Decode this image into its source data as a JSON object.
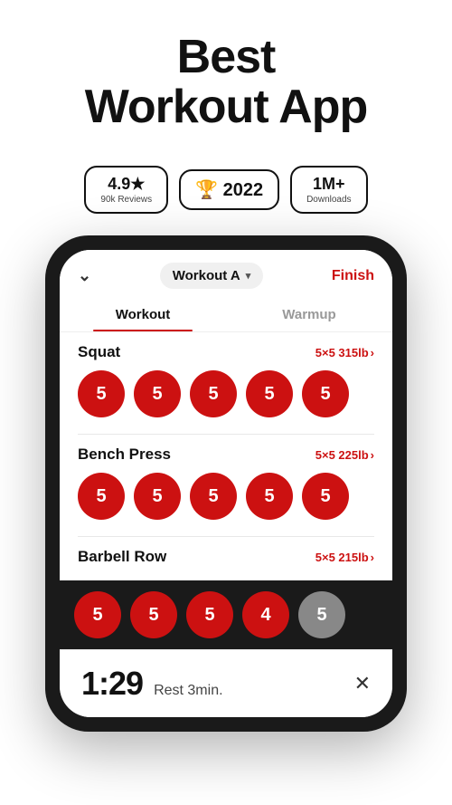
{
  "header": {
    "title_line1": "Best",
    "title_line2": "Workout App"
  },
  "badges": [
    {
      "id": "rating",
      "main": "4.9★",
      "sub": "90k Reviews"
    },
    {
      "id": "award",
      "main": "🏆 2022",
      "sub": ""
    },
    {
      "id": "downloads",
      "main": "1M+",
      "sub": "Downloads"
    }
  ],
  "phone": {
    "workout_label": "Workout A",
    "finish_label": "Finish",
    "tabs": [
      {
        "id": "workout",
        "label": "Workout",
        "active": true
      },
      {
        "id": "warmup",
        "label": "Warmup",
        "active": false
      }
    ],
    "exercises": [
      {
        "name": "Squat",
        "detail": "5×5 315lb",
        "sets": [
          5,
          5,
          5,
          5,
          5
        ],
        "gray": []
      },
      {
        "name": "Bench Press",
        "detail": "5×5 225lb",
        "sets": [
          5,
          5,
          5,
          5,
          5
        ],
        "gray": []
      },
      {
        "name": "Barbell Row",
        "detail": "5×5 215lb",
        "sets": [
          5,
          5,
          5,
          4,
          5
        ],
        "gray": [
          4
        ]
      }
    ],
    "bottom_sets": [
      5,
      5,
      5,
      4,
      5
    ],
    "bottom_gray_index": 4,
    "timer": {
      "time": "1:29",
      "label": "Rest 3min."
    }
  },
  "icons": {
    "chevron_down": "⌄",
    "selector_arrow": "▾",
    "chevron_right": "›",
    "close": "✕"
  }
}
